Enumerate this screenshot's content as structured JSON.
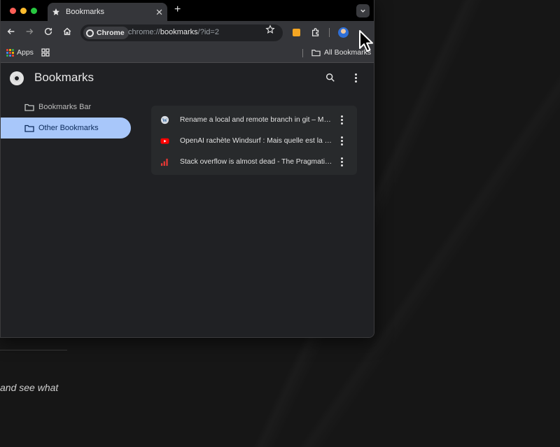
{
  "browser": {
    "tab": {
      "title": "Bookmarks"
    },
    "omnibox": {
      "chip_label": "Chrome",
      "url_scheme": "chrome://",
      "url_host": "bookmarks",
      "url_path": "/?id=2"
    },
    "bookmarks_bar": {
      "apps_label": "Apps",
      "all_bookmarks_label": "All Bookmarks"
    }
  },
  "page": {
    "title": "Bookmarks",
    "sidebar": {
      "items": [
        {
          "label": "Bookmarks Bar",
          "active": false
        },
        {
          "label": "Other Bookmarks",
          "active": true
        }
      ]
    },
    "bookmarks": [
      {
        "title": "Rename a local and remote branch in git – Mult…",
        "favicon": "wordpress-icon"
      },
      {
        "title": "OpenAI rachète Windsurf : Mais quelle est la vr…",
        "favicon": "youtube-icon"
      },
      {
        "title": "Stack overflow is almost dead - The Pragmatic…",
        "favicon": "signal-bars-icon"
      }
    ]
  },
  "background": {
    "caption_fragment": "and see what"
  },
  "colors": {
    "accent": "#a8c7fa",
    "youtube_red": "#ff0000",
    "pragmatic_red": "#e53935",
    "extension_orange": "#f4a623"
  }
}
